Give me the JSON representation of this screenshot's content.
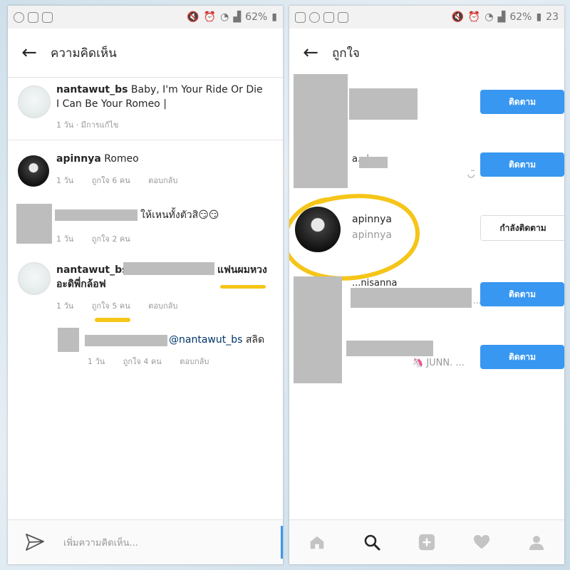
{
  "status_bar": {
    "battery": "62%",
    "clock_partial": "23"
  },
  "comments_screen": {
    "title": "ความคิดเห็น",
    "caption": {
      "username": "nantawut_bs",
      "line1": "Baby, I'm Your Ride Or Die",
      "line2": "I Can Be Your Romeo |",
      "meta": "1 วัน · มีการแก้ไข"
    },
    "comments": [
      {
        "username": "apinnya",
        "text": "Romeo",
        "time": "1 วัน",
        "likes": "ถูกใจ 6 คน",
        "reply": "ตอบกลับ"
      },
      {
        "text": "ให้เหนทั้งตัวสิ😏😏",
        "time": "1 วัน",
        "likes": "ถูกใจ 2 คน"
      },
      {
        "username": "nantawut_bs",
        "text_end": "แฟนผมหวง",
        "line2": "อะดิพี่กล้อฟ",
        "time": "1 วัน",
        "likes": "ถูกใจ 5 คน",
        "reply": "ตอบกลับ"
      },
      {
        "mention": "@nantawut_bs",
        "text": "สลิด",
        "time": "1 วัน",
        "likes": "ถูกใจ 4 คน",
        "reply": "ตอบกลับ"
      }
    ],
    "input_placeholder": "เพิ่มความคิดเห็น..."
  },
  "likes_screen": {
    "title": "ถูกใจ",
    "rows": [
      {
        "button": "ติดตาม"
      },
      {
        "username_partial": "a...i",
        "subtitle": "◡̈",
        "button": "ติดตาม"
      },
      {
        "username": "apinnya",
        "name": "apinnya",
        "button": "กำลังติดตาม"
      },
      {
        "username_partial": "...nisanna",
        "subtitle": "...",
        "button": "ติดตาม"
      },
      {
        "subtitle": "🦄 JUNN. ...",
        "button": "ติดตาม"
      }
    ]
  },
  "colors": {
    "follow_blue": "#3897f0",
    "highlight_yellow": "#f5c518"
  }
}
